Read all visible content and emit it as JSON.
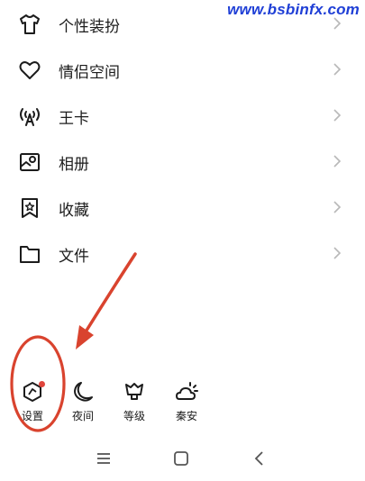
{
  "watermark": "www.bsbinfx.com",
  "menu": {
    "items": [
      {
        "label": "个性装扮",
        "icon": "tshirt-icon"
      },
      {
        "label": "情侣空间",
        "icon": "heart-icon"
      },
      {
        "label": "王卡",
        "icon": "signal-tower-icon"
      },
      {
        "label": "相册",
        "icon": "photo-icon"
      },
      {
        "label": "收藏",
        "icon": "bookmark-star-icon"
      },
      {
        "label": "文件",
        "icon": "folder-icon"
      }
    ]
  },
  "bottom": {
    "settings_label": "设置",
    "night_label": "夜间",
    "level_label": "等级",
    "sleep_label": "秦安"
  },
  "colors": {
    "text": "#1c1c1c",
    "chevron": "#b8b8b8",
    "accent_red": "#e0453c",
    "annotation_red": "#d9432e",
    "watermark_blue": "#1f3fd6"
  }
}
